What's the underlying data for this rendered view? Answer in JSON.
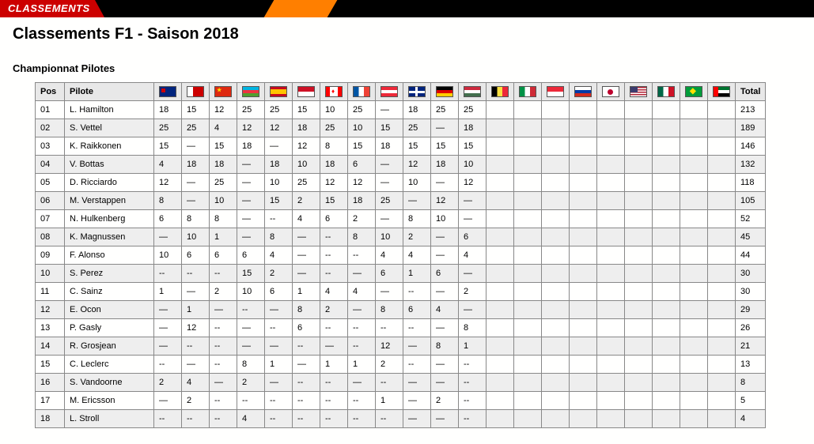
{
  "banner": {
    "label": "CLASSEMENTS"
  },
  "title": "Classements F1 - Saison 2018",
  "section": "Championnat Pilotes",
  "headers": {
    "pos": "Pos",
    "pilote": "Pilote",
    "total": "Total"
  },
  "races": [
    {
      "code": "AUS"
    },
    {
      "code": "BHR"
    },
    {
      "code": "CHN"
    },
    {
      "code": "AZE"
    },
    {
      "code": "ESP"
    },
    {
      "code": "MON"
    },
    {
      "code": "CAN"
    },
    {
      "code": "FRA"
    },
    {
      "code": "AUT"
    },
    {
      "code": "GBR"
    },
    {
      "code": "GER"
    },
    {
      "code": "HUN"
    },
    {
      "code": "BEL"
    },
    {
      "code": "ITA"
    },
    {
      "code": "SIN"
    },
    {
      "code": "RUS"
    },
    {
      "code": "JPN"
    },
    {
      "code": "USA"
    },
    {
      "code": "MEX"
    },
    {
      "code": "BRA"
    },
    {
      "code": "UAE"
    }
  ],
  "drivers": [
    {
      "pos": "01",
      "name": "L. Hamilton",
      "pts": [
        "18",
        "15",
        "12",
        "25",
        "25",
        "15",
        "10",
        "25",
        "—",
        "18",
        "25",
        "25",
        "",
        "",
        "",
        "",
        "",
        "",
        "",
        "",
        ""
      ],
      "total": "213"
    },
    {
      "pos": "02",
      "name": "S. Vettel",
      "pts": [
        "25",
        "25",
        "4",
        "12",
        "12",
        "18",
        "25",
        "10",
        "15",
        "25",
        "—",
        "18",
        "",
        "",
        "",
        "",
        "",
        "",
        "",
        "",
        ""
      ],
      "total": "189"
    },
    {
      "pos": "03",
      "name": "K. Raikkonen",
      "pts": [
        "15",
        "—",
        "15",
        "18",
        "—",
        "12",
        "8",
        "15",
        "18",
        "15",
        "15",
        "15",
        "",
        "",
        "",
        "",
        "",
        "",
        "",
        "",
        ""
      ],
      "total": "146"
    },
    {
      "pos": "04",
      "name": "V. Bottas",
      "pts": [
        "4",
        "18",
        "18",
        "—",
        "18",
        "10",
        "18",
        "6",
        "—",
        "12",
        "18",
        "10",
        "",
        "",
        "",
        "",
        "",
        "",
        "",
        "",
        ""
      ],
      "total": "132"
    },
    {
      "pos": "05",
      "name": "D. Ricciardo",
      "pts": [
        "12",
        "—",
        "25",
        "—",
        "10",
        "25",
        "12",
        "12",
        "—",
        "10",
        "—",
        "12",
        "",
        "",
        "",
        "",
        "",
        "",
        "",
        "",
        ""
      ],
      "total": "118"
    },
    {
      "pos": "06",
      "name": "M. Verstappen",
      "pts": [
        "8",
        "—",
        "10",
        "—",
        "15",
        "2",
        "15",
        "18",
        "25",
        "—",
        "12",
        "—",
        "",
        "",
        "",
        "",
        "",
        "",
        "",
        "",
        ""
      ],
      "total": "105"
    },
    {
      "pos": "07",
      "name": "N. Hulkenberg",
      "pts": [
        "6",
        "8",
        "8",
        "—",
        "--",
        "4",
        "6",
        "2",
        "—",
        "8",
        "10",
        "—",
        "",
        "",
        "",
        "",
        "",
        "",
        "",
        "",
        ""
      ],
      "total": "52"
    },
    {
      "pos": "08",
      "name": "K. Magnussen",
      "pts": [
        "—",
        "10",
        "1",
        "—",
        "8",
        "—",
        "--",
        "8",
        "10",
        "2",
        "—",
        "6",
        "",
        "",
        "",
        "",
        "",
        "",
        "",
        "",
        ""
      ],
      "total": "45"
    },
    {
      "pos": "09",
      "name": "F. Alonso",
      "pts": [
        "10",
        "6",
        "6",
        "6",
        "4",
        "—",
        "--",
        "--",
        "4",
        "4",
        "—",
        "4",
        "",
        "",
        "",
        "",
        "",
        "",
        "",
        "",
        ""
      ],
      "total": "44"
    },
    {
      "pos": "10",
      "name": "S. Perez",
      "pts": [
        "--",
        "--",
        "--",
        "15",
        "2",
        "—",
        "--",
        "—",
        "6",
        "1",
        "6",
        "—",
        "",
        "",
        "",
        "",
        "",
        "",
        "",
        "",
        ""
      ],
      "total": "30"
    },
    {
      "pos": "11",
      "name": "C. Sainz",
      "pts": [
        "1",
        "—",
        "2",
        "10",
        "6",
        "1",
        "4",
        "4",
        "—",
        "--",
        "—",
        "2",
        "",
        "",
        "",
        "",
        "",
        "",
        "",
        "",
        ""
      ],
      "total": "30"
    },
    {
      "pos": "12",
      "name": "E. Ocon",
      "pts": [
        "—",
        "1",
        "—",
        "--",
        "—",
        "8",
        "2",
        "—",
        "8",
        "6",
        "4",
        "—",
        "",
        "",
        "",
        "",
        "",
        "",
        "",
        "",
        ""
      ],
      "total": "29"
    },
    {
      "pos": "13",
      "name": "P. Gasly",
      "pts": [
        "—",
        "12",
        "--",
        "—",
        "--",
        "6",
        "--",
        "--",
        "--",
        "--",
        "—",
        "8",
        "",
        "",
        "",
        "",
        "",
        "",
        "",
        "",
        ""
      ],
      "total": "26"
    },
    {
      "pos": "14",
      "name": "R. Grosjean",
      "pts": [
        "—",
        "--",
        "--",
        "—",
        "—",
        "--",
        "—",
        "--",
        "12",
        "—",
        "8",
        "1",
        "",
        "",
        "",
        "",
        "",
        "",
        "",
        "",
        ""
      ],
      "total": "21"
    },
    {
      "pos": "15",
      "name": "C. Leclerc",
      "pts": [
        "--",
        "—",
        "--",
        "8",
        "1",
        "—",
        "1",
        "1",
        "2",
        "--",
        "—",
        "--",
        "",
        "",
        "",
        "",
        "",
        "",
        "",
        "",
        ""
      ],
      "total": "13"
    },
    {
      "pos": "16",
      "name": "S. Vandoorne",
      "pts": [
        "2",
        "4",
        "—",
        "2",
        "—",
        "--",
        "--",
        "—",
        "--",
        "—",
        "—",
        "--",
        "",
        "",
        "",
        "",
        "",
        "",
        "",
        "",
        ""
      ],
      "total": "8"
    },
    {
      "pos": "17",
      "name": "M. Ericsson",
      "pts": [
        "—",
        "2",
        "--",
        "--",
        "--",
        "--",
        "--",
        "--",
        "1",
        "—",
        "2",
        "--",
        "",
        "",
        "",
        "",
        "",
        "",
        "",
        "",
        ""
      ],
      "total": "5"
    },
    {
      "pos": "18",
      "name": "L. Stroll",
      "pts": [
        "--",
        "--",
        "--",
        "4",
        "--",
        "--",
        "--",
        "--",
        "--",
        "—",
        "—",
        "--",
        "",
        "",
        "",
        "",
        "",
        "",
        "",
        "",
        ""
      ],
      "total": "4"
    }
  ]
}
